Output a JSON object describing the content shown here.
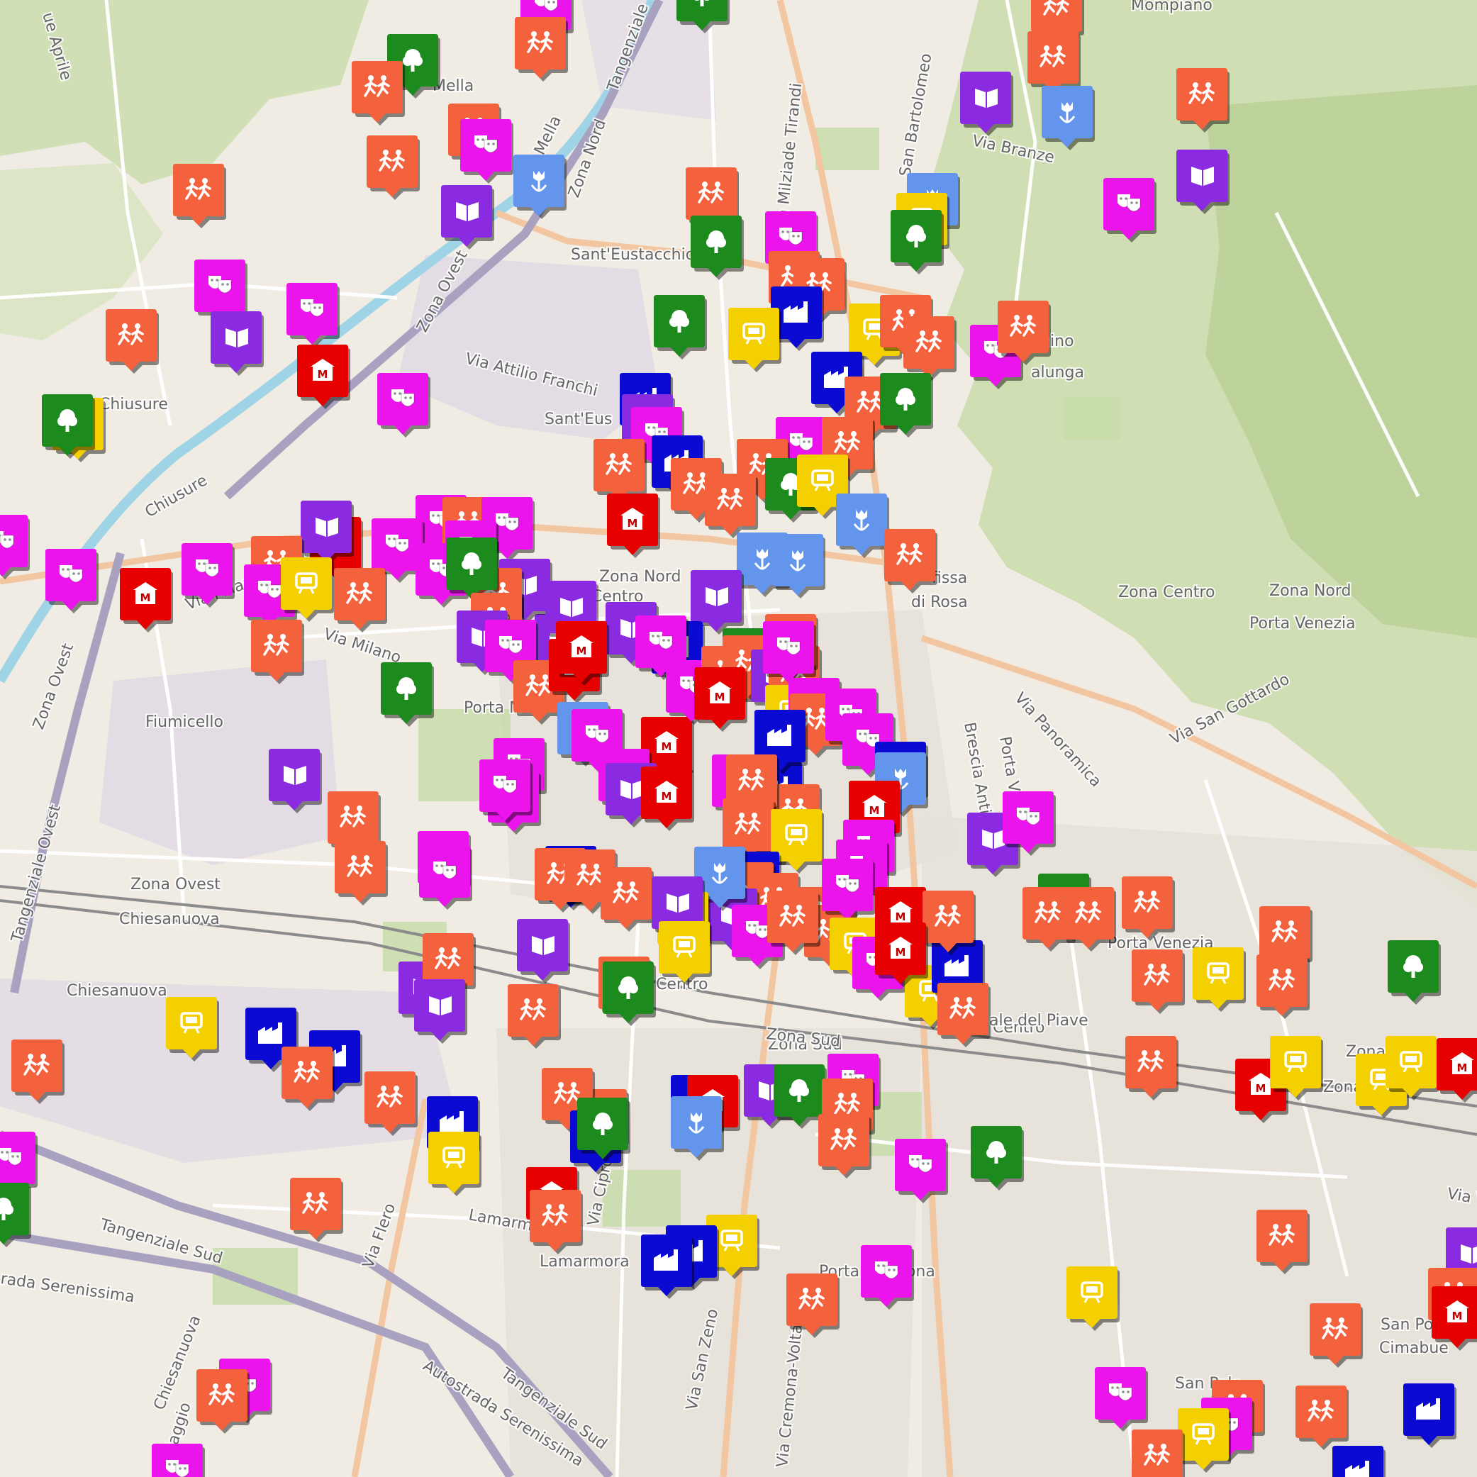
{
  "map": {
    "place_labels": [
      "Mompiano",
      "Mella",
      "Chiusure",
      "Sant'Eustacchio",
      "Sant'Eus",
      "Fiumicello",
      "Porta M",
      "Zona Ovest",
      "Chiesanuova",
      "Chiesanuova",
      "Zona Nord",
      "Zona Centro",
      "Zona Centro",
      "Zona Nord",
      "Porta Venezia",
      "Porta Venezia",
      "Zona Sud",
      "Lamarmora",
      "Porta Cremona",
      "San Polo",
      "San Polo",
      "Cimabue",
      "fissa",
      "di Rosa",
      "Centro",
      "Centro",
      "Zona",
      "Zona",
      "Brescia Antica",
      "chino",
      "alunga",
      "Porta Ve",
      "ale del Piave"
    ],
    "street_labels": [
      "Tangenziale",
      "Via Milziade Tirandi",
      "Via Branze",
      "Via Attilio Franchi",
      "Zona Ovest",
      "Via Milano",
      "Via Milano",
      "Tangenziale Ovest",
      "Via Panoramica",
      "Via San Gottardo",
      "Via Flero",
      "Via San Zeno",
      "Via Cremona-Volta",
      "Zona Sud",
      "Tangenziale Sud",
      "Autostrada Serenissima",
      "Tangenziale Sud",
      "rada Serenissima",
      "Via Cipro",
      "Lamarmora",
      "Chiesanuova",
      "Villaggio",
      "Mella",
      "Zona Nord",
      "Chiusure",
      "Zona Ovest",
      "San Bartolomeo",
      "Via Apriile",
      "Via V",
      "ue Aprile",
      "Via Ci"
    ],
    "colors": {
      "sport": "#f4623d",
      "theatre": "#ec14ec",
      "library": "#8a2be2",
      "park": "#1d8a1d",
      "monument": "#e60000",
      "garden": "#6495ed",
      "industry": "#0a0ad2",
      "cinema": "#f5d000"
    },
    "marker_categories": {
      "sport": "people-running-icon",
      "theatre": "theatre-masks-icon",
      "library": "open-book-icon",
      "park": "tree-icon",
      "monument": "museum-m-icon",
      "garden": "tulip-icon",
      "industry": "factory-icon",
      "cinema": "screen-icon"
    }
  }
}
